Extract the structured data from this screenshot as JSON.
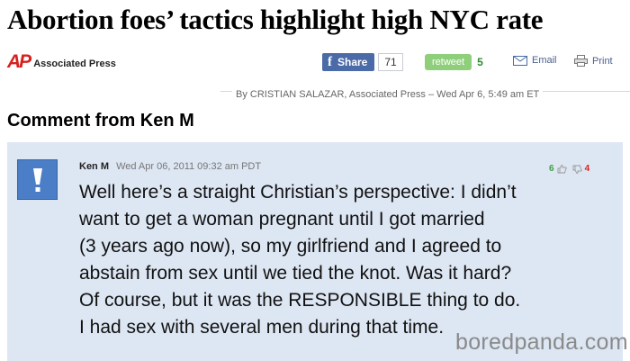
{
  "article": {
    "headline": "Abortion foes’ tactics highlight high NYC rate",
    "publisher_mark": "AP",
    "publisher_name": "Associated Press",
    "byline": "By CRISTIAN SALAZAR, Associated Press – Wed Apr 6, 5:49 am ET"
  },
  "toolbar": {
    "share_label": "Share",
    "share_count": "71",
    "retweet_label": "retweet",
    "retweet_count": "5",
    "email_label": "Email",
    "print_label": "Print"
  },
  "section": {
    "title": "Comment from Ken M"
  },
  "comment": {
    "author": "Ken M",
    "timestamp": "Wed Apr 06, 2011 09:32 am PDT",
    "thumbs_up": "6",
    "thumbs_down": "4",
    "lines": [
      "Well here’s a straight Christian’s perspective: I didn’t",
      "want to get a woman pregnant until I got married",
      "(3 years ago now), so my girlfriend and I agreed to",
      "abstain from sex until we tied the knot. Was it hard?",
      "Of course, but it was the RESPONSIBLE thing to do.",
      "I had sex with several men during that time."
    ]
  },
  "watermark": "boredpanda.com",
  "colors": {
    "ap_red": "#d6211f",
    "facebook_blue": "#4a6aa8",
    "retweet_green": "#8fcf7c",
    "comment_bg": "#dde6f3",
    "avatar_blue": "#4b7ec6"
  }
}
